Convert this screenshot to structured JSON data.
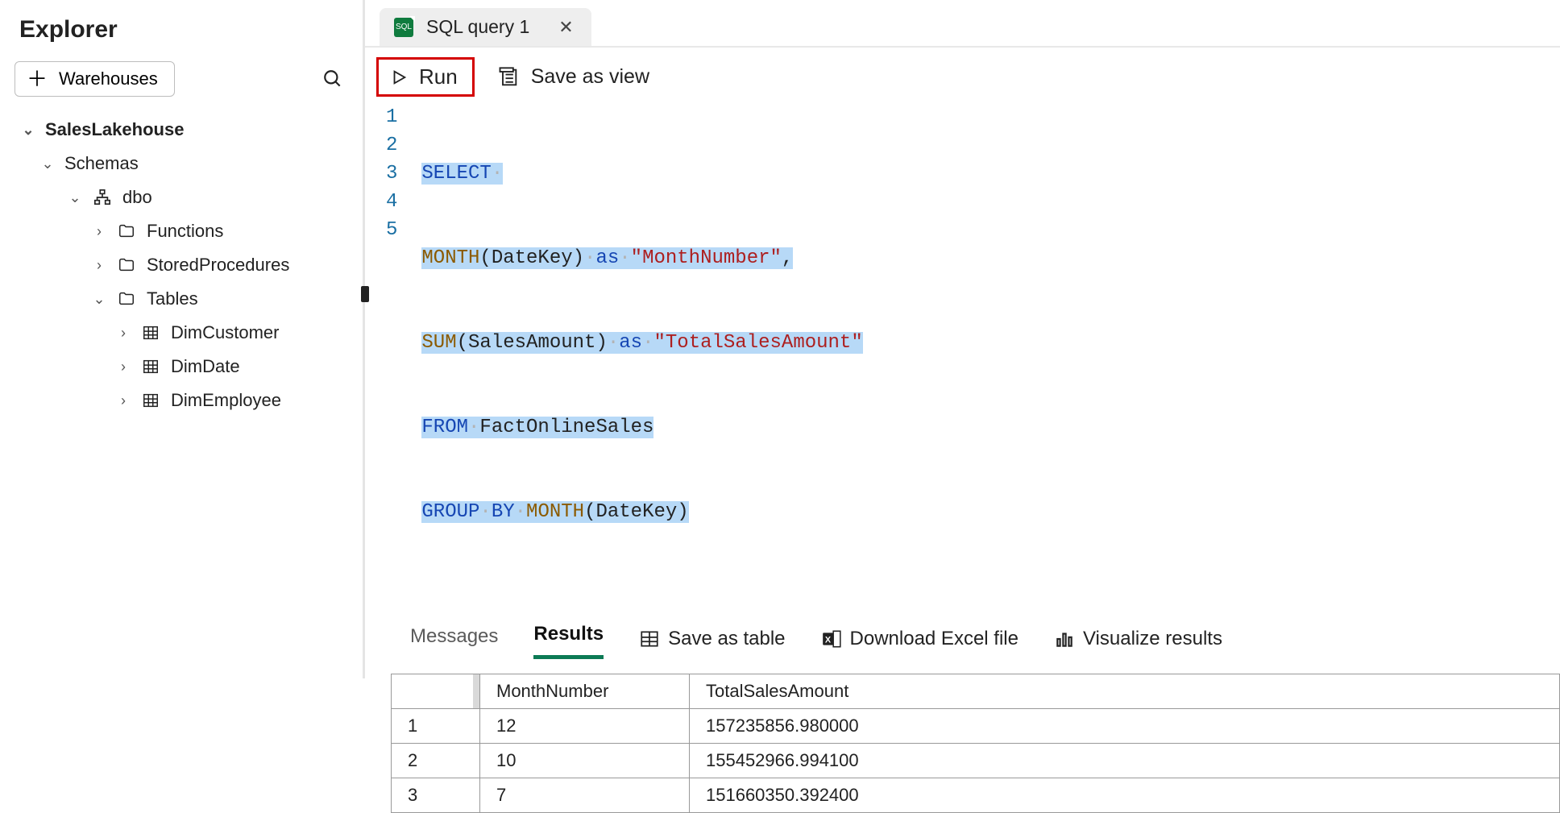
{
  "explorer": {
    "title": "Explorer",
    "warehouses_label": "Warehouses",
    "tree": {
      "database": "SalesLakehouse",
      "schemas_label": "Schemas",
      "schema": "dbo",
      "folders": {
        "functions": "Functions",
        "stored_procedures": "StoredProcedures",
        "tables": "Tables"
      },
      "tables": [
        "DimCustomer",
        "DimDate",
        "DimEmployee"
      ]
    }
  },
  "tab": {
    "label": "SQL query 1"
  },
  "toolbar": {
    "run": "Run",
    "save_as_view": "Save as view"
  },
  "code": {
    "lines": [
      {
        "n": "1",
        "tokens": [
          "SELECT"
        ]
      },
      {
        "n": "2",
        "tokens": [
          "MONTH",
          "(",
          "DateKey",
          ")",
          " as ",
          "\"MonthNumber\"",
          ","
        ]
      },
      {
        "n": "3",
        "tokens": [
          "SUM",
          "(",
          "SalesAmount",
          ")",
          " as ",
          "\"TotalSalesAmount\""
        ]
      },
      {
        "n": "4",
        "tokens": [
          "FROM ",
          "FactOnlineSales"
        ]
      },
      {
        "n": "5",
        "tokens": [
          "GROUP BY ",
          "MONTH",
          "(",
          "DateKey",
          ")"
        ]
      }
    ],
    "raw": "SELECT\nMONTH(DateKey) as \"MonthNumber\",\nSUM(SalesAmount) as \"TotalSalesAmount\"\nFROM FactOnlineSales\nGROUP BY MONTH(DateKey)"
  },
  "results": {
    "tabs": {
      "messages": "Messages",
      "results": "Results"
    },
    "active_tab": "results",
    "actions": {
      "save_table": "Save as table",
      "download_excel": "Download Excel file",
      "visualize": "Visualize results"
    },
    "columns": [
      "MonthNumber",
      "TotalSalesAmount"
    ],
    "rows": [
      {
        "idx": "1",
        "MonthNumber": "12",
        "TotalSalesAmount": "157235856.980000"
      },
      {
        "idx": "2",
        "MonthNumber": "10",
        "TotalSalesAmount": "155452966.994100"
      },
      {
        "idx": "3",
        "MonthNumber": "7",
        "TotalSalesAmount": "151660350.392400"
      }
    ]
  }
}
